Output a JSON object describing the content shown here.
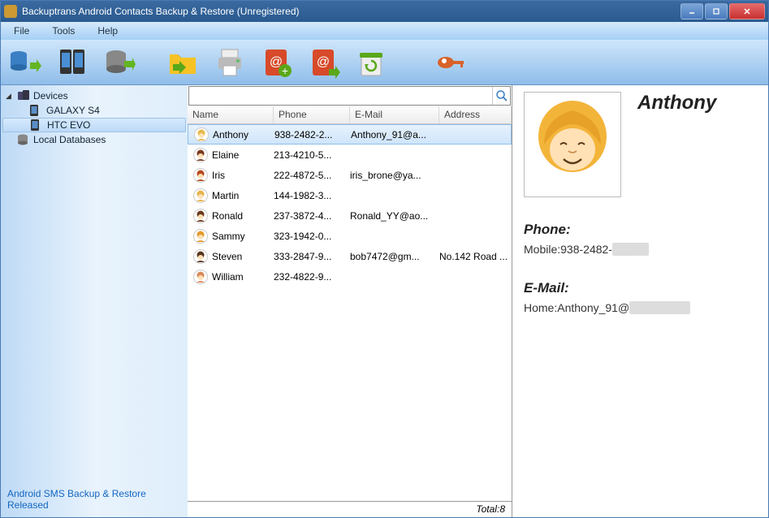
{
  "window": {
    "title": "Backuptrans Android Contacts Backup & Restore (Unregistered)"
  },
  "menubar": {
    "file": "File",
    "tools": "Tools",
    "help": "Help"
  },
  "sidebar": {
    "devices_label": "Devices",
    "devices": [
      {
        "name": "GALAXY S4"
      },
      {
        "name": "HTC EVO"
      }
    ],
    "local_db_label": "Local Databases",
    "footer_link": "Android SMS Backup & Restore Released"
  },
  "columns": {
    "name": "Name",
    "phone": "Phone",
    "email": "E-Mail",
    "address": "Address"
  },
  "search": {
    "placeholder": ""
  },
  "contacts": [
    {
      "name": "Anthony",
      "phone": "938-2482-2...",
      "email": "Anthony_91@a...",
      "address": "",
      "color": "#e7b94a"
    },
    {
      "name": "Elaine",
      "phone": "213-4210-5...",
      "email": "",
      "address": "",
      "color": "#7b3b1f"
    },
    {
      "name": "Iris",
      "phone": "222-4872-5...",
      "email": "iris_brone@ya...",
      "address": "",
      "color": "#b74a1e"
    },
    {
      "name": "Martin",
      "phone": "144-1982-3...",
      "email": "",
      "address": "",
      "color": "#e4b347"
    },
    {
      "name": "Ronald",
      "phone": "237-3872-4...",
      "email": "Ronald_YY@ao...",
      "address": "",
      "color": "#6b3a1e"
    },
    {
      "name": "Sammy",
      "phone": "323-1942-0...",
      "email": "",
      "address": "",
      "color": "#e69a2a"
    },
    {
      "name": "Steven",
      "phone": "333-2847-9...",
      "email": "bob7472@gm...",
      "address": "No.142 Road ...",
      "color": "#5a3520"
    },
    {
      "name": "William",
      "phone": "232-4822-9...",
      "email": "",
      "address": "",
      "color": "#d98b5a"
    }
  ],
  "total": {
    "label": "Total:",
    "value": 8
  },
  "detail": {
    "name": "Anthony",
    "phone_label": "Phone:",
    "phone_type": "Mobile:",
    "phone_value": "938-2482-",
    "email_label": "E-Mail:",
    "email_type": "Home:",
    "email_value": "Anthony_91@"
  }
}
